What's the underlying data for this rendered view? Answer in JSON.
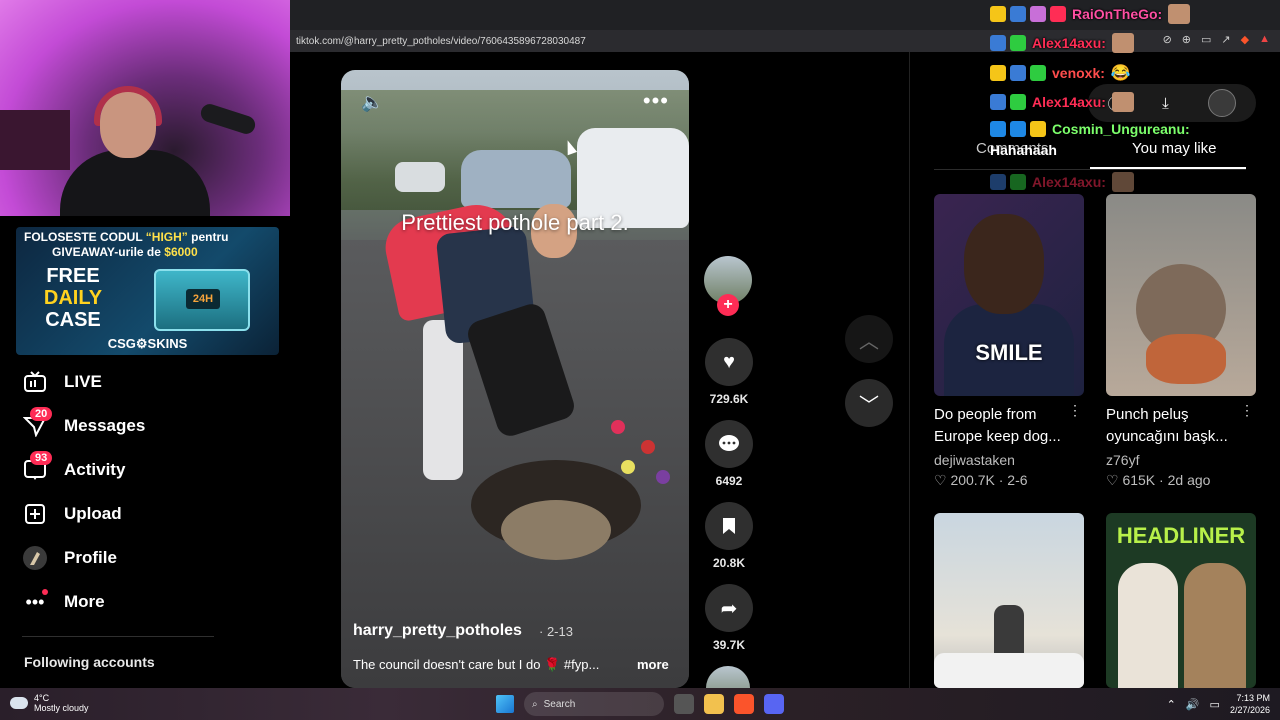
{
  "browser": {
    "url": "tiktok.com/@harry_pretty_potholes/video/7606435896728030487",
    "url_icons": [
      "no-translate-icon",
      "zoom-icon",
      "cast-icon",
      "share-icon",
      "brave-shield-icon",
      "rewards-icon"
    ]
  },
  "sponsor": {
    "line1_prefix": "FOLOSESTE CODUL ",
    "line1_code": "“HIGH”",
    "line1_suffix": " pentru",
    "line2_prefix": "GIVEAWAY-urile de ",
    "line2_amount": "$6000",
    "free_1": "FREE",
    "free_2": "DAILY",
    "free_3": "CASE",
    "case_label": "24H",
    "brand": "CSG⚙SKINS"
  },
  "sidebar": {
    "items": [
      {
        "label": "LIVE",
        "icon": "live-tv-icon"
      },
      {
        "label": "Messages",
        "icon": "messages-icon",
        "badge": "20"
      },
      {
        "label": "Activity",
        "icon": "activity-icon",
        "badge": "93"
      },
      {
        "label": "Upload",
        "icon": "upload-plus-icon"
      },
      {
        "label": "Profile",
        "icon": "profile-avatar-icon"
      },
      {
        "label": "More",
        "icon": "more-dots-icon"
      }
    ],
    "following_title": "Following accounts"
  },
  "video": {
    "caption": "Prettiest pothole part 2.",
    "author": "harry_pretty_potholes",
    "date": "· 2-13",
    "description": "The council doesn't care but I do 🌹 #fyp...",
    "more_label": "more"
  },
  "actions": {
    "likes": "729.6K",
    "comments": "6492",
    "saves": "20.8K",
    "shares": "39.7K"
  },
  "right_panel": {
    "tabs": [
      "Comments",
      "You may like"
    ],
    "active_tab": "You may like",
    "cards": [
      {
        "title": "Do people from Europe keep dog...",
        "author": "dejiwastaken",
        "likes": "200.7K",
        "date": "2-6",
        "thumb_text": "SMILE"
      },
      {
        "title": "Punch peluş oyuncağını başk...",
        "author": "z76yf",
        "likes": "615K",
        "date": "2d ago"
      },
      {
        "title": "",
        "author": "",
        "likes": "",
        "date": ""
      },
      {
        "title": "",
        "author": "",
        "likes": "",
        "date": "",
        "thumb_text": "HEADLINER"
      }
    ]
  },
  "chat": {
    "rows": [
      {
        "name": "RaiOnTheGo:",
        "color": "#ff4fa3"
      },
      {
        "name": "Alex14axu:",
        "color": "#ff2d55"
      },
      {
        "name": "venoxk:",
        "color": "#ff4d4d",
        "emoji": "😂"
      },
      {
        "name": "Alex14axu:",
        "color": "#ff2d55"
      },
      {
        "name": "Cosmin_Ungureanu:",
        "color": "#7cff6b"
      },
      {
        "name": "Alex14axu:",
        "color": "#ff2d55"
      }
    ],
    "message": "Hahahaah"
  },
  "taskbar": {
    "temperature": "4°C",
    "weather": "Mostly cloudy",
    "search_placeholder": "Search",
    "time": "7:13 PM",
    "date": "2/27/2026"
  }
}
